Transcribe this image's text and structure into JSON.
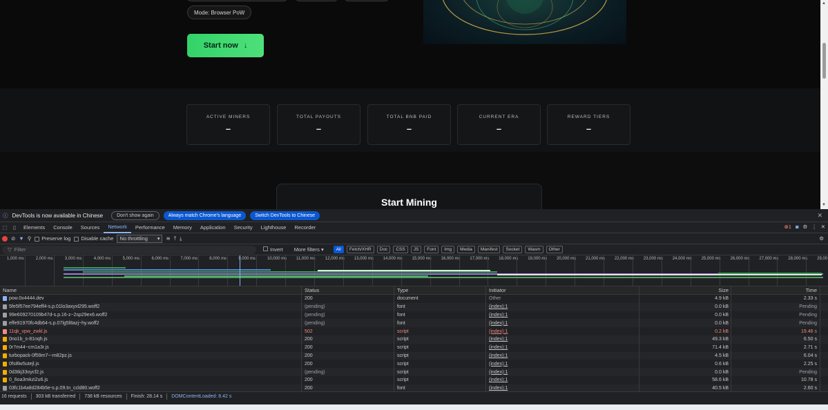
{
  "site": {
    "mode_pill": "Mode: Browser PoW",
    "start_button": "Start now",
    "stats": [
      {
        "label": "ACTIVE MINERS",
        "value": "–"
      },
      {
        "label": "TOTAL PAYOUTS",
        "value": "–"
      },
      {
        "label": "TOTAL BNB PAID",
        "value": "–"
      },
      {
        "label": "CURRENT ERA",
        "value": "–"
      },
      {
        "label": "REWARD TIERS",
        "value": "–"
      }
    ],
    "mining_title": "Start Mining"
  },
  "devtools": {
    "banner": {
      "message": "DevTools is now available in Chinese",
      "dont_show": "Don't show again",
      "match_lang": "Always match Chrome's language",
      "switch": "Switch DevTools to Chinese"
    },
    "tabs": [
      "Elements",
      "Console",
      "Sources",
      "Network",
      "Performance",
      "Memory",
      "Application",
      "Security",
      "Lighthouse",
      "Recorder"
    ],
    "active_tab": "Network",
    "error_count": "1",
    "toolbar": {
      "preserve_log": "Preserve log",
      "disable_cache": "Disable cache",
      "throttling": "No throttling"
    },
    "filter": {
      "placeholder": "Filter",
      "invert": "Invert",
      "more_filters": "More filters",
      "chips": [
        "All",
        "Fetch/XHR",
        "Doc",
        "CSS",
        "JS",
        "Font",
        "Img",
        "Media",
        "Manifest",
        "Socket",
        "Wasm",
        "Other"
      ]
    },
    "timeline_ticks": [
      "1,000 ms",
      "2,000 ms",
      "3,000 ms",
      "4,000 ms",
      "5,000 ms",
      "6,000 ms",
      "7,000 ms",
      "8,000 ms",
      "9,000 ms",
      "10,000 ms",
      "11,000 ms",
      "12,000 ms",
      "13,000 ms",
      "14,000 ms",
      "15,000 ms",
      "16,000 ms",
      "17,000 ms",
      "18,000 ms",
      "19,000 ms",
      "20,000 ms",
      "21,000 ms",
      "22,000 ms",
      "23,000 ms",
      "24,000 ms",
      "25,000 ms",
      "26,000 ms",
      "27,000 ms",
      "28,000 ms",
      "29,00"
    ],
    "columns": {
      "name": "Name",
      "status": "Status",
      "type": "Type",
      "initiator": "Initiator",
      "size": "Size",
      "time": "Time"
    },
    "requests": [
      {
        "name": "pow.0x4444.dev",
        "status": "200",
        "type": "document",
        "initiator": "Other",
        "size": "4.9 kB",
        "time": "2.33 s",
        "kind": "doc",
        "error": false
      },
      {
        "name": "5fe5f57ee794eff4-s.p.01lo3axyxl295.woff2",
        "status": "(pending)",
        "type": "font",
        "initiator": "(index):1",
        "size": "0.0 kB",
        "time": "Pending",
        "kind": "font",
        "error": false
      },
      {
        "name": "99e609270109b47d-s.p.16-z~2sp29ex6.woff2",
        "status": "(pending)",
        "type": "font",
        "initiator": "(index):1",
        "size": "0.0 kB",
        "time": "Pending",
        "kind": "font",
        "error": false
      },
      {
        "name": "effe91970fc4db64-s.p.07lg5l8azj~hy.woff2",
        "status": "(pending)",
        "type": "font",
        "initiator": "(index):1",
        "size": "0.0 kB",
        "time": "Pending",
        "kind": "font",
        "error": false
      },
      {
        "name": "11qk_vpw_zwkl.js",
        "status": "502",
        "type": "script",
        "initiator": "(index):1",
        "size": "0.2 kB",
        "time": "19.46 s",
        "kind": "error",
        "error": true
      },
      {
        "name": "0no1b_s-81nqh.js",
        "status": "200",
        "type": "script",
        "initiator": "(index):1",
        "size": "49.3 kB",
        "time": "6.50 s",
        "kind": "script",
        "error": false
      },
      {
        "name": "0r7m44~cm1a3r.js",
        "status": "200",
        "type": "script",
        "initiator": "(index):1",
        "size": "71.4 kB",
        "time": "2.71 s",
        "kind": "script",
        "error": false
      },
      {
        "name": "turbopack-0f59m7~-m82pz.js",
        "status": "200",
        "type": "script",
        "initiator": "(index):1",
        "size": "4.5 kB",
        "time": "6.04 s",
        "kind": "script",
        "error": false
      },
      {
        "name": "0fs8lw5utejl.js",
        "status": "200",
        "type": "script",
        "initiator": "(index):1",
        "size": "0.6 kB",
        "time": "2.25 s",
        "kind": "script",
        "error": false
      },
      {
        "name": "0d3tkj33oycf2.js",
        "status": "(pending)",
        "type": "script",
        "initiator": "(index):1",
        "size": "0.0 kB",
        "time": "Pending",
        "kind": "script",
        "error": false
      },
      {
        "name": "0_6oa3mkzi2u6.js",
        "status": "200",
        "type": "script",
        "initiator": "(index):1",
        "size": "58.6 kB",
        "time": "10.78 s",
        "kind": "script",
        "error": false
      },
      {
        "name": "03fc1b4a8d284b5e-s.p.09.tn_ccld80.woff2",
        "status": "200",
        "type": "font",
        "initiator": "(index):1",
        "size": "40.5 kB",
        "time": "2.60 s",
        "kind": "font",
        "error": false
      }
    ],
    "summary": {
      "requests": "16 requests",
      "transferred": "303 kB transferred",
      "resources": "738 kB resources",
      "finish": "Finish: 28.14 s",
      "dcl": "DOMContentLoaded: 8.42 s"
    }
  },
  "colors": {
    "accent_green": "#34d26a",
    "devtools_blue": "#8ab4f8",
    "error_red": "#f28b82"
  }
}
